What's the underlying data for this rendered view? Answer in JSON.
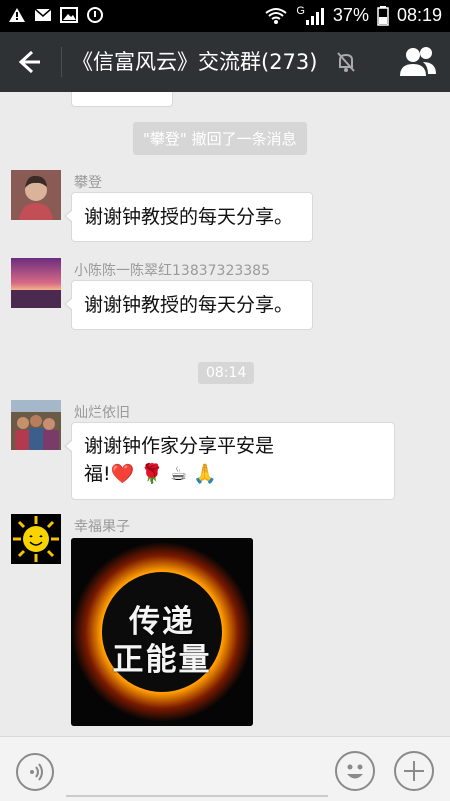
{
  "status_bar": {
    "battery": "37%",
    "time": "08:19",
    "network_type": "G"
  },
  "header": {
    "title": "《信富风云》交流群(273)",
    "back_icon": "back-arrow",
    "mute_icon": "bell-muted",
    "members_icon": "group-members"
  },
  "chat": {
    "recall_notice": "\"攀登\" 撤回了一条消息",
    "time_divider": "08:14",
    "messages": [
      {
        "sender": "攀登",
        "text": "谢谢钟教授的每天分享。"
      },
      {
        "sender": "小陈陈一陈翠红13837323385",
        "text": "谢谢钟教授的每天分享。"
      },
      {
        "sender": "灿烂依旧",
        "text_line1": "谢谢钟作家分享平安是",
        "text_line2": "福!❤️ 🌹 ☕ 🙏"
      },
      {
        "sender": "幸福果子",
        "image_text_line1": "传递",
        "image_text_line2": "正能量"
      }
    ]
  },
  "bottom_bar": {
    "voice_icon": "voice-input",
    "emoji_icon": "emoji-smile",
    "plus_icon": "plus-more"
  },
  "colors": {
    "header_bg": "#2f3234",
    "chat_bg": "#ebebeb",
    "status_bg": "#000000"
  }
}
